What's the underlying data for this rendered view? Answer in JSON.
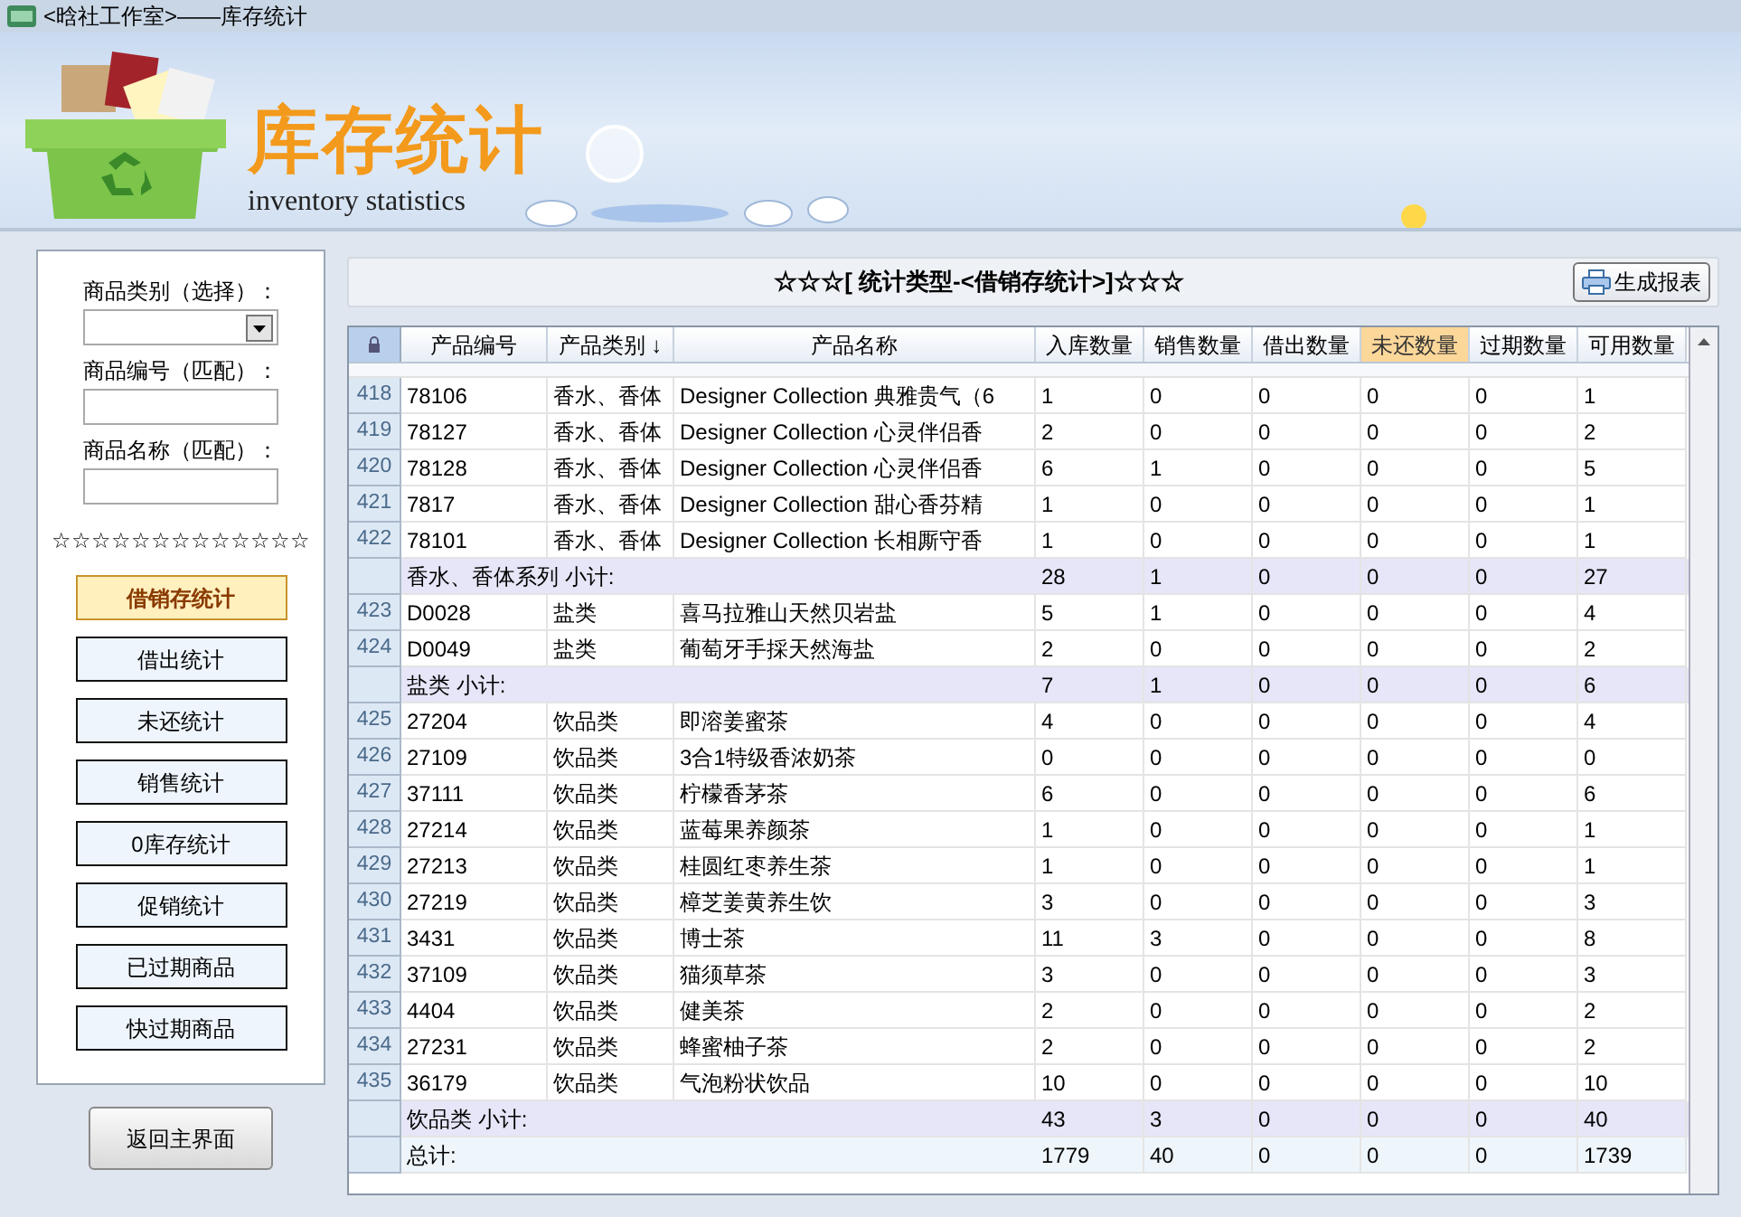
{
  "window": {
    "title": "<晗社工作室>——库存统计"
  },
  "banner": {
    "title": "库存统计",
    "subtitle": "inventory statistics"
  },
  "filters": [
    {
      "kind": "select",
      "label": "商品类别（选择）："
    },
    {
      "kind": "text",
      "label": "商品编号（匹配）："
    },
    {
      "kind": "text",
      "label": "商品名称（匹配）："
    }
  ],
  "divider_stars": "☆☆☆☆☆☆☆☆☆☆☆☆☆",
  "stat_buttons": [
    {
      "label": "借销存统计",
      "selected": true
    },
    {
      "label": "借出统计",
      "selected": false
    },
    {
      "label": "未还统计",
      "selected": false
    },
    {
      "label": "销售统计",
      "selected": false
    },
    {
      "label": "0库存统计",
      "selected": false
    },
    {
      "label": "促销统计",
      "selected": false
    },
    {
      "label": "已过期商品",
      "selected": false
    },
    {
      "label": "快过期商品",
      "selected": false
    }
  ],
  "back_button": "返回主界面",
  "report_title": "☆☆☆[ 统计类型-<借销存统计>]☆☆☆",
  "report_button": "生成报表",
  "table": {
    "columns": [
      {
        "label": "产品编号",
        "selected": false
      },
      {
        "label": "产品类别 ↓",
        "selected": false
      },
      {
        "label": "产品名称",
        "selected": false
      },
      {
        "label": "入库数量",
        "selected": false
      },
      {
        "label": "销售数量",
        "selected": false
      },
      {
        "label": "借出数量",
        "selected": false
      },
      {
        "label": "未还数量",
        "selected": true
      },
      {
        "label": "过期数量",
        "selected": false
      },
      {
        "label": "可用数量",
        "selected": false
      }
    ],
    "rows": [
      {
        "kind": "item",
        "num": "418",
        "cells": [
          "78106",
          "香水、香体",
          "Designer Collection 典雅贵气（6",
          "1",
          "0",
          "0",
          "0",
          "0",
          "1"
        ]
      },
      {
        "kind": "item",
        "num": "419",
        "cells": [
          "78127",
          "香水、香体",
          "Designer Collection 心灵伴侣香",
          "2",
          "0",
          "0",
          "0",
          "0",
          "2"
        ]
      },
      {
        "kind": "item",
        "num": "420",
        "cells": [
          "78128",
          "香水、香体",
          "Designer Collection 心灵伴侣香",
          "6",
          "1",
          "0",
          "0",
          "0",
          "5"
        ]
      },
      {
        "kind": "item",
        "num": "421",
        "cells": [
          "7817",
          "香水、香体",
          "Designer Collection 甜心香芬精",
          "1",
          "0",
          "0",
          "0",
          "0",
          "1"
        ]
      },
      {
        "kind": "item",
        "num": "422",
        "cells": [
          "78101",
          "香水、香体",
          "Designer Collection 长相厮守香",
          "1",
          "0",
          "0",
          "0",
          "0",
          "1"
        ]
      },
      {
        "kind": "subtotal",
        "label": "香水、香体系列 小计:",
        "cells": [
          "28",
          "1",
          "0",
          "0",
          "0",
          "27"
        ]
      },
      {
        "kind": "item",
        "num": "423",
        "cells": [
          "D0028",
          "盐类",
          "喜马拉雅山天然贝岩盐",
          "5",
          "1",
          "0",
          "0",
          "0",
          "4"
        ]
      },
      {
        "kind": "item",
        "num": "424",
        "cells": [
          "D0049",
          "盐类",
          "葡萄牙手採天然海盐",
          "2",
          "0",
          "0",
          "0",
          "0",
          "2"
        ]
      },
      {
        "kind": "subtotal",
        "label": "盐类 小计:",
        "cells": [
          "7",
          "1",
          "0",
          "0",
          "0",
          "6"
        ]
      },
      {
        "kind": "item",
        "num": "425",
        "cells": [
          "27204",
          "饮品类",
          "即溶姜蜜茶",
          "4",
          "0",
          "0",
          "0",
          "0",
          "4"
        ]
      },
      {
        "kind": "item",
        "num": "426",
        "cells": [
          "27109",
          "饮品类",
          "3合1特级香浓奶茶",
          "0",
          "0",
          "0",
          "0",
          "0",
          "0"
        ]
      },
      {
        "kind": "item",
        "num": "427",
        "cells": [
          "37111",
          "饮品类",
          "柠檬香茅茶",
          "6",
          "0",
          "0",
          "0",
          "0",
          "6"
        ]
      },
      {
        "kind": "item",
        "num": "428",
        "cells": [
          "27214",
          "饮品类",
          "蓝莓果养颜茶",
          "1",
          "0",
          "0",
          "0",
          "0",
          "1"
        ]
      },
      {
        "kind": "item",
        "num": "429",
        "cells": [
          "27213",
          "饮品类",
          "桂圆红枣养生茶",
          "1",
          "0",
          "0",
          "0",
          "0",
          "1"
        ]
      },
      {
        "kind": "item",
        "num": "430",
        "cells": [
          "27219",
          "饮品类",
          "樟芝姜黄养生饮",
          "3",
          "0",
          "0",
          "0",
          "0",
          "3"
        ]
      },
      {
        "kind": "item",
        "num": "431",
        "cells": [
          "3431",
          "饮品类",
          "博士茶",
          "11",
          "3",
          "0",
          "0",
          "0",
          "8"
        ]
      },
      {
        "kind": "item",
        "num": "432",
        "cells": [
          "37109",
          "饮品类",
          "猫须草茶",
          "3",
          "0",
          "0",
          "0",
          "0",
          "3"
        ]
      },
      {
        "kind": "item",
        "num": "433",
        "cells": [
          "4404",
          "饮品类",
          "健美茶",
          "2",
          "0",
          "0",
          "0",
          "0",
          "2"
        ]
      },
      {
        "kind": "item",
        "num": "434",
        "cells": [
          "27231",
          "饮品类",
          "蜂蜜柚子茶",
          "2",
          "0",
          "0",
          "0",
          "0",
          "2"
        ]
      },
      {
        "kind": "item",
        "num": "435",
        "cells": [
          "36179",
          "饮品类",
          "气泡粉状饮品",
          "10",
          "0",
          "0",
          "0",
          "0",
          "10"
        ]
      },
      {
        "kind": "subtotal",
        "label": "饮品类 小计:",
        "cells": [
          "43",
          "3",
          "0",
          "0",
          "0",
          "40"
        ]
      },
      {
        "kind": "total",
        "label": "总计:",
        "cells": [
          "1779",
          "40",
          "0",
          "0",
          "0",
          "1739"
        ]
      }
    ]
  }
}
